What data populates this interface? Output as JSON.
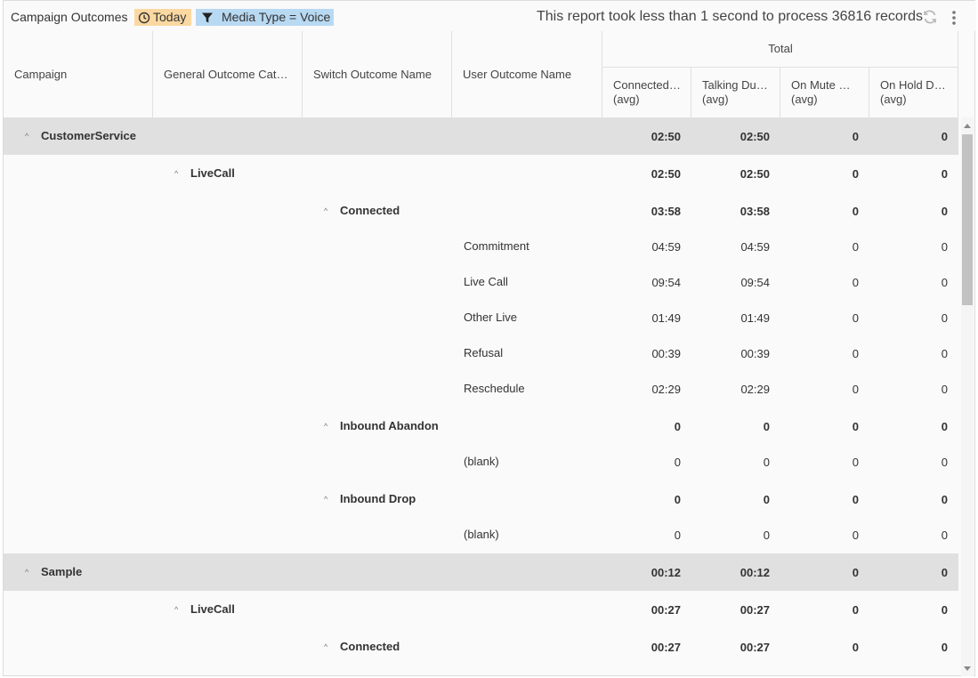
{
  "toolbar": {
    "title": "Campaign Outcomes",
    "time_chip": "Today",
    "filter_chip": "Media Type = Voice",
    "status": "This report took less than 1 second to process 36816 records"
  },
  "header": {
    "columns": {
      "campaign": "Campaign",
      "general_outcome": "General Outcome Category",
      "switch_outcome": "Switch Outcome Name",
      "user_outcome": "User Outcome Name"
    },
    "total_label": "Total",
    "measures": [
      {
        "name": "Connected Duration",
        "agg": "(avg)"
      },
      {
        "name": "Talking Duration",
        "agg": "(avg)"
      },
      {
        "name": "On Mute Duration",
        "agg": "(avg)"
      },
      {
        "name": "On Hold Duration",
        "agg": "(avg)"
      }
    ]
  },
  "rows": [
    {
      "level": 0,
      "label": "CustomerService",
      "values": [
        "02:50",
        "02:50",
        "0",
        "0"
      ]
    },
    {
      "level": 1,
      "label": "LiveCall",
      "values": [
        "02:50",
        "02:50",
        "0",
        "0"
      ]
    },
    {
      "level": 2,
      "label": "Connected",
      "values": [
        "03:58",
        "03:58",
        "0",
        "0"
      ]
    },
    {
      "level": 3,
      "label": "Commitment",
      "values": [
        "04:59",
        "04:59",
        "0",
        "0"
      ]
    },
    {
      "level": 3,
      "label": "Live Call",
      "values": [
        "09:54",
        "09:54",
        "0",
        "0"
      ]
    },
    {
      "level": 3,
      "label": "Other Live",
      "values": [
        "01:49",
        "01:49",
        "0",
        "0"
      ]
    },
    {
      "level": 3,
      "label": "Refusal",
      "values": [
        "00:39",
        "00:39",
        "0",
        "0"
      ]
    },
    {
      "level": 3,
      "label": "Reschedule",
      "values": [
        "02:29",
        "02:29",
        "0",
        "0"
      ]
    },
    {
      "level": 2,
      "label": "Inbound Abandon",
      "values": [
        "0",
        "0",
        "0",
        "0"
      ]
    },
    {
      "level": 3,
      "label": "(blank)",
      "values": [
        "0",
        "0",
        "0",
        "0"
      ]
    },
    {
      "level": 2,
      "label": "Inbound Drop",
      "values": [
        "0",
        "0",
        "0",
        "0"
      ]
    },
    {
      "level": 3,
      "label": "(blank)",
      "values": [
        "0",
        "0",
        "0",
        "0"
      ]
    },
    {
      "level": 0,
      "label": "Sample",
      "values": [
        "00:12",
        "00:12",
        "0",
        "0"
      ]
    },
    {
      "level": 1,
      "label": "LiveCall",
      "values": [
        "00:27",
        "00:27",
        "0",
        "0"
      ]
    },
    {
      "level": 2,
      "label": "Connected",
      "values": [
        "00:27",
        "00:27",
        "0",
        "0"
      ]
    }
  ],
  "icons": {
    "time": "clock-icon",
    "filter": "filter-icon",
    "refresh": "refresh-icon",
    "menu": "more-vertical-icon",
    "collapse": "chevron-up-icon"
  },
  "colors": {
    "time_chip": "#fbd8a1",
    "filter_chip": "#b8d9f2",
    "group_row": "#e0e0e0"
  }
}
